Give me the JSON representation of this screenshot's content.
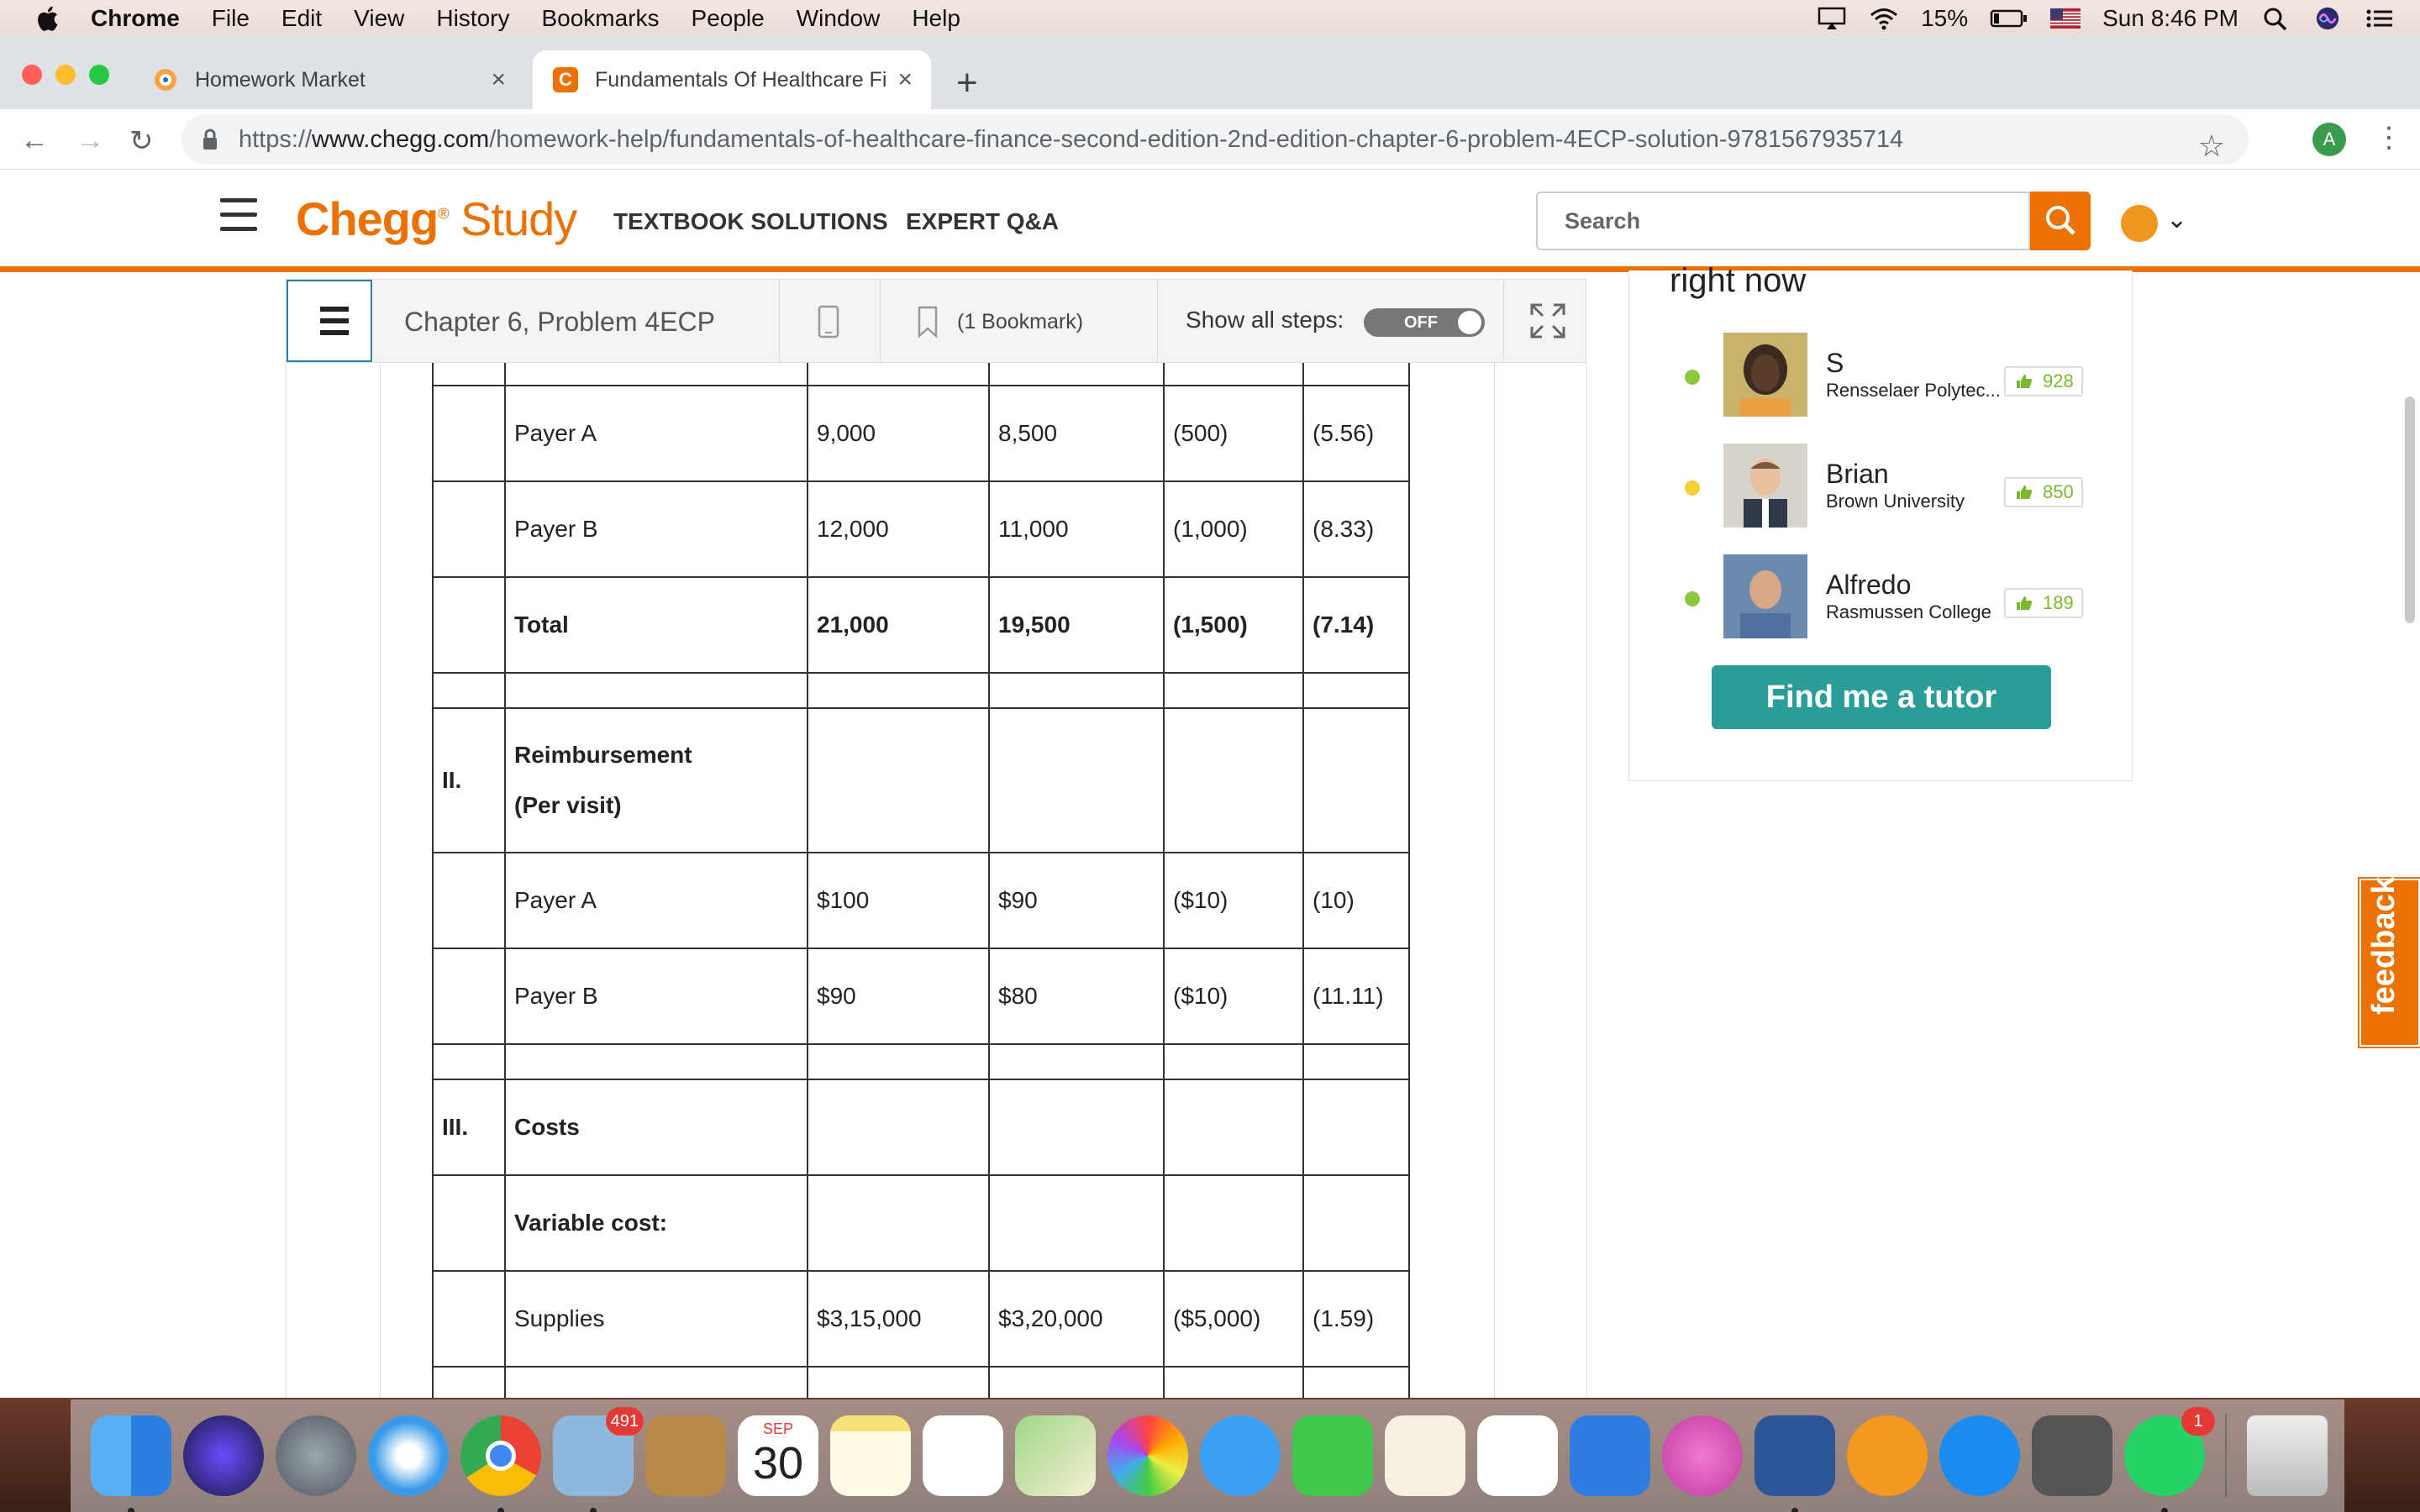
{
  "menubar": {
    "app": "Chrome",
    "items": [
      "File",
      "Edit",
      "View",
      "History",
      "Bookmarks",
      "People",
      "Window",
      "Help"
    ],
    "battery": "15%",
    "clock": "Sun 8:46 PM"
  },
  "tabs": [
    {
      "title": "Homework Market"
    },
    {
      "title": "Fundamentals Of Healthcare Fi"
    }
  ],
  "address_bar": {
    "scheme": "https://",
    "host": "www.chegg.com",
    "path": "/homework-help/fundamentals-of-healthcare-finance-second-edition-2nd-edition-chapter-6-problem-4ECP-solution-9781567935714"
  },
  "profile_initial": "A",
  "chegg": {
    "logo_main": "Chegg",
    "logo_mark": "®",
    "logo_sub": "Study",
    "nav": [
      "TEXTBOOK SOLUTIONS",
      "EXPERT Q&A"
    ],
    "search_placeholder": "Search"
  },
  "problem_bar": {
    "title": "Chapter 6, Problem 4ECP",
    "bookmark": "(1 Bookmark)",
    "show_steps_label": "Show all steps:",
    "toggle_state": "OFF"
  },
  "table_rows": [
    {
      "c0": "",
      "c1": "",
      "c2": "",
      "c3": "",
      "c4": "",
      "c5": "",
      "bold": false,
      "h": 28
    },
    {
      "c0": "",
      "c1": "Payer A",
      "c2": "9,000",
      "c3": "8,500",
      "c4": "(500)",
      "c5": "(5.56)",
      "bold": false,
      "h": 114
    },
    {
      "c0": "",
      "c1": "Payer B",
      "c2": "12,000",
      "c3": "11,000",
      "c4": "(1,000)",
      "c5": "(8.33)",
      "bold": false,
      "h": 114
    },
    {
      "c0": "",
      "c1": "Total",
      "c2": "21,000",
      "c3": "19,500",
      "c4": "(1,500)",
      "c5": "(7.14)",
      "bold": true,
      "h": 114
    },
    {
      "c0": "",
      "c1": "",
      "c2": "",
      "c3": "",
      "c4": "",
      "c5": "",
      "bold": false,
      "h": 42
    },
    {
      "c0": "II.",
      "c1": "Reimbursement\n(Per visit)",
      "c2": "",
      "c3": "",
      "c4": "",
      "c5": "",
      "bold": true,
      "h": 172
    },
    {
      "c0": "",
      "c1": "Payer A",
      "c2": "$100",
      "c3": "$90",
      "c4": "($10)",
      "c5": "(10)",
      "bold": false,
      "h": 114
    },
    {
      "c0": "",
      "c1": "Payer B",
      "c2": "$90",
      "c3": "$80",
      "c4": "($10)",
      "c5": "(11.11)",
      "bold": false,
      "h": 114
    },
    {
      "c0": "",
      "c1": "",
      "c2": "",
      "c3": "",
      "c4": "",
      "c5": "",
      "bold": false,
      "h": 42
    },
    {
      "c0": "III.",
      "c1": "Costs",
      "c2": "",
      "c3": "",
      "c4": "",
      "c5": "",
      "bold": true,
      "h": 114
    },
    {
      "c0": "",
      "c1": "Variable cost:",
      "c2": "",
      "c3": "",
      "c4": "",
      "c5": "",
      "bold": true,
      "h": 114
    },
    {
      "c0": "",
      "c1": "Supplies",
      "c2": "$3,15,000",
      "c3": "$3,20,000",
      "c4": "($5,000)",
      "c5": "(1.59)",
      "bold": false,
      "h": 114
    },
    {
      "c0": "",
      "c1": "",
      "c2": "",
      "c3": "",
      "c4": "",
      "c5": "",
      "bold": false,
      "h": 60
    }
  ],
  "tutors": {
    "heading": "right now",
    "list": [
      {
        "name": "S",
        "school": "Rensselaer Polytec...",
        "score": "928",
        "status_color": "#8dc63f"
      },
      {
        "name": "Brian",
        "school": "Brown University",
        "score": "850",
        "status_color": "#f5d033"
      },
      {
        "name": "Alfredo",
        "school": "Rasmussen College",
        "score": "189",
        "status_color": "#8dc63f"
      }
    ],
    "cta": "Find me a tutor"
  },
  "feedback_label": "feedback",
  "dock": {
    "mail_badge": "491",
    "calendar_month": "SEP",
    "calendar_day": "30",
    "whatsapp_badge": "1"
  },
  "colors": {
    "chegg_orange": "#eb7100",
    "tutor_teal": "#2a9d98",
    "score_green": "#7ab82f"
  }
}
